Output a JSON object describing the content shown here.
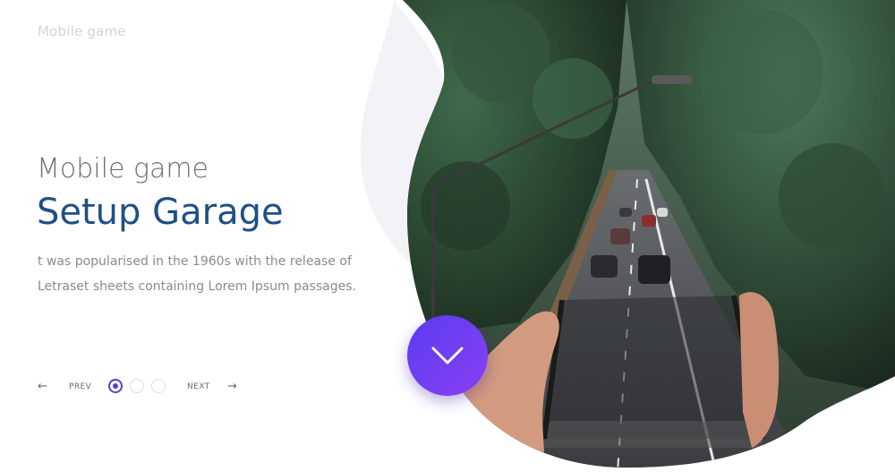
{
  "brand": "Mobile game",
  "hero": {
    "subtitle": "Mobile game",
    "title": "Setup Garage",
    "text_line1": "t was popularised in the 1960s with the release of",
    "text_line2": "Letraset sheets containing Lorem Ipsum passages."
  },
  "pager": {
    "prev_label": "PREV",
    "next_label": "NEXT",
    "prev_icon": "arrow-left-icon",
    "next_icon": "arrow-right-icon",
    "dots": 3,
    "active_index": 0
  },
  "colors": {
    "accent": "#5a3fd6",
    "title": "#1f4f86",
    "blob": "#f2f2f7"
  },
  "scroll_button": {
    "icon": "chevron-down-icon"
  }
}
